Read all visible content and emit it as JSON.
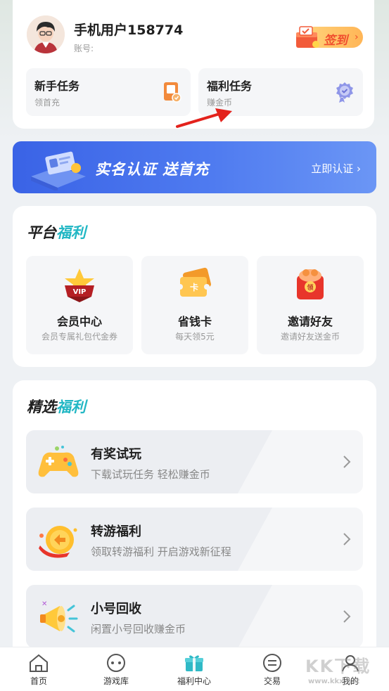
{
  "user": {
    "name": "手机用户158774",
    "account_label": "账号:",
    "signin_label": "签到"
  },
  "tasks": [
    {
      "title": "新手任务",
      "subtitle": "领首充",
      "icon": "tablet-gift-icon"
    },
    {
      "title": "福利任务",
      "subtitle": "赚金币",
      "icon": "badge-icon"
    }
  ],
  "banner": {
    "title": "实名认证  送首充",
    "cta": "立即认证 ›"
  },
  "platform": {
    "title_plain": "平台",
    "title_accent": "福利",
    "items": [
      {
        "name": "会员中心",
        "desc": "会员专属礼包代金券",
        "icon": "vip-crown-icon"
      },
      {
        "name": "省钱卡",
        "desc": "每天领5元",
        "icon": "ticket-card-icon"
      },
      {
        "name": "邀请好友",
        "desc": "邀请好友送金币",
        "icon": "red-envelope-icon"
      }
    ]
  },
  "selected": {
    "title_plain": "精选",
    "title_accent": "福利",
    "items": [
      {
        "name": "有奖试玩",
        "desc": "下载试玩任务 轻松赚金币",
        "icon": "gamepad-icon"
      },
      {
        "name": "转游福利",
        "desc": "领取转游福利 开启游戏新征程",
        "icon": "coin-swap-icon"
      },
      {
        "name": "小号回收",
        "desc": "闲置小号回收赚金币",
        "icon": "megaphone-icon"
      }
    ]
  },
  "tabbar": [
    {
      "label": "首页",
      "icon": "home-icon"
    },
    {
      "label": "游戏库",
      "icon": "game-library-icon"
    },
    {
      "label": "福利中心",
      "icon": "gift-icon",
      "active": true
    },
    {
      "label": "交易",
      "icon": "trade-icon"
    },
    {
      "label": "我的",
      "icon": "profile-icon"
    }
  ],
  "colors": {
    "accent": "#22b7c4",
    "banner_blue": "#3a63e6",
    "signin_red": "#f04e2e",
    "arrow_red": "#e3221c"
  },
  "watermark": {
    "text": "KK下载",
    "sub": "www.kkx.net"
  }
}
